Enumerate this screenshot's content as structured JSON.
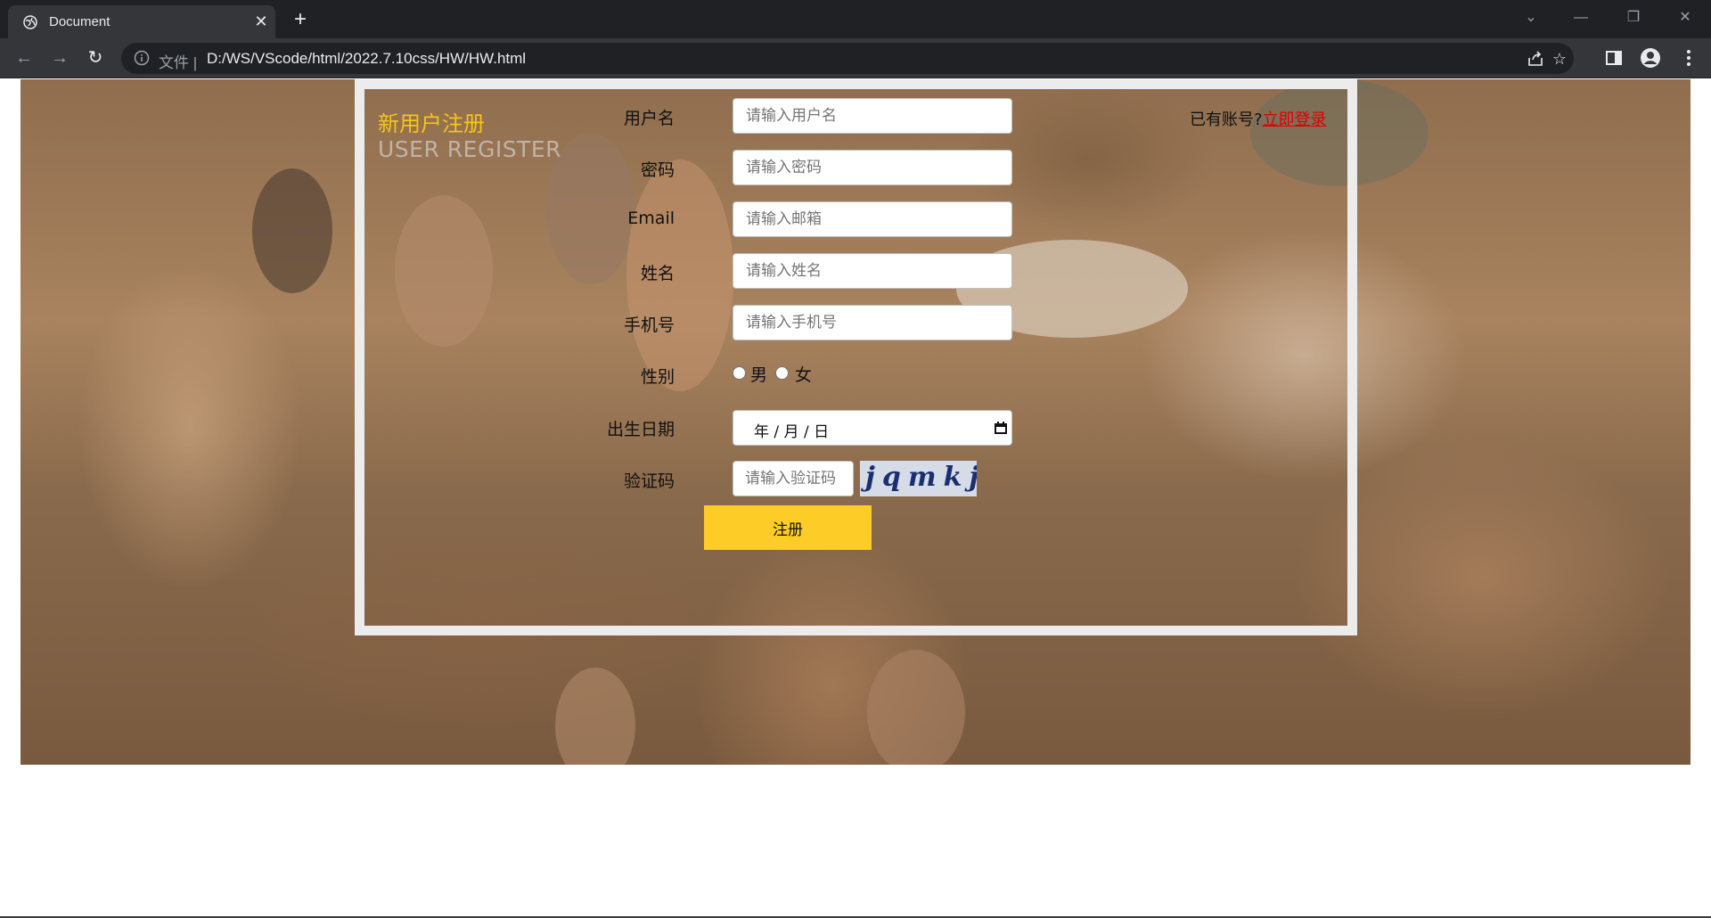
{
  "browser": {
    "tab_title": "Document",
    "tab_close": "✕",
    "new_tab": "+",
    "address_scheme_label": "文件",
    "address_separator": "|",
    "url": "D:/WS/VScode/html/2022.7.10css/HW/HW.html"
  },
  "page": {
    "title_cn": "新用户注册",
    "title_en": "USER REGISTER",
    "login_hint": "已有账号?",
    "login_link": "立即登录",
    "fields": [
      {
        "label": "用户名",
        "placeholder": "请输入用户名"
      },
      {
        "label": "密码",
        "placeholder": "请输入密码"
      },
      {
        "label": "Email",
        "placeholder": "请输入邮箱"
      },
      {
        "label": "姓名",
        "placeholder": "请输入姓名"
      },
      {
        "label": "手机号",
        "placeholder": "请输入手机号"
      }
    ],
    "gender": {
      "label": "性别",
      "options": [
        "男",
        "女"
      ]
    },
    "birthday": {
      "label": "出生日期",
      "value": "年 / 月 / 日"
    },
    "captcha": {
      "label": "验证码",
      "placeholder": "请输入验证码",
      "image_text": "jqmkj"
    },
    "submit_label": "注册",
    "colors": {
      "accent": "#fecc27",
      "title": "#f5c518",
      "link": "#e00000",
      "panel_border": "#ececec"
    }
  }
}
